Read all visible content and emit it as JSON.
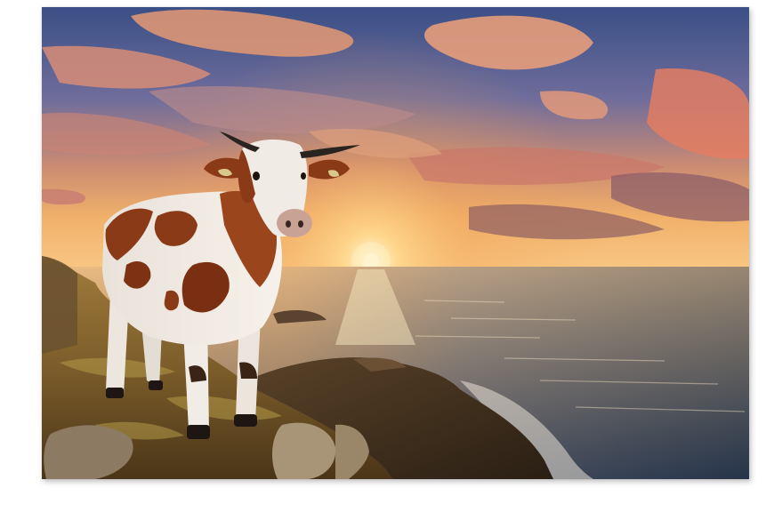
{
  "artwork": {
    "subject": "cow-on-sea-cliff-at-sunset",
    "colors": {
      "sky_top": "#3a4f86",
      "sky_mid": "#7a6f9a",
      "horizon_glow": "#f5b760",
      "sun": "#fff6d8",
      "sea_dark": "#26364c",
      "sea_light": "#d9a874",
      "cliff": "#8a6a32",
      "cow_brown": "#8b3a17",
      "cow_white": "#f1ece6"
    }
  }
}
